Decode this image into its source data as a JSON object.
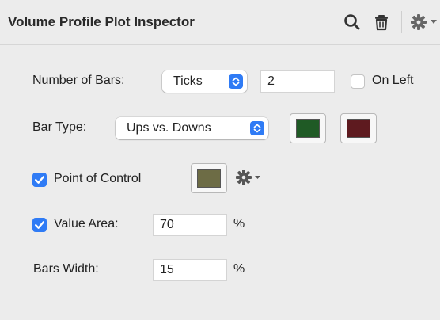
{
  "header": {
    "title": "Volume Profile Plot Inspector",
    "icons": [
      "search-icon",
      "trash-icon",
      "gear-dropdown-icon"
    ]
  },
  "rows": {
    "number_of_bars": {
      "label": "Number of Bars:",
      "mode_value": "Ticks",
      "count_value": "2",
      "on_left_label": "On Left",
      "on_left_checked": false
    },
    "bar_type": {
      "label": "Bar Type:",
      "value": "Ups vs. Downs",
      "up_color": "#1f5a25",
      "down_color": "#5e1a1f"
    },
    "point_of_control": {
      "label": "Point of Control",
      "checked": true,
      "color": "#6d6c45"
    },
    "value_area": {
      "label": "Value Area:",
      "checked": true,
      "value": "70",
      "unit": "%"
    },
    "bars_width": {
      "label": "Bars Width:",
      "value": "15",
      "unit": "%"
    }
  },
  "colors": {
    "accent": "#2f7bf5",
    "background": "#ececec"
  }
}
